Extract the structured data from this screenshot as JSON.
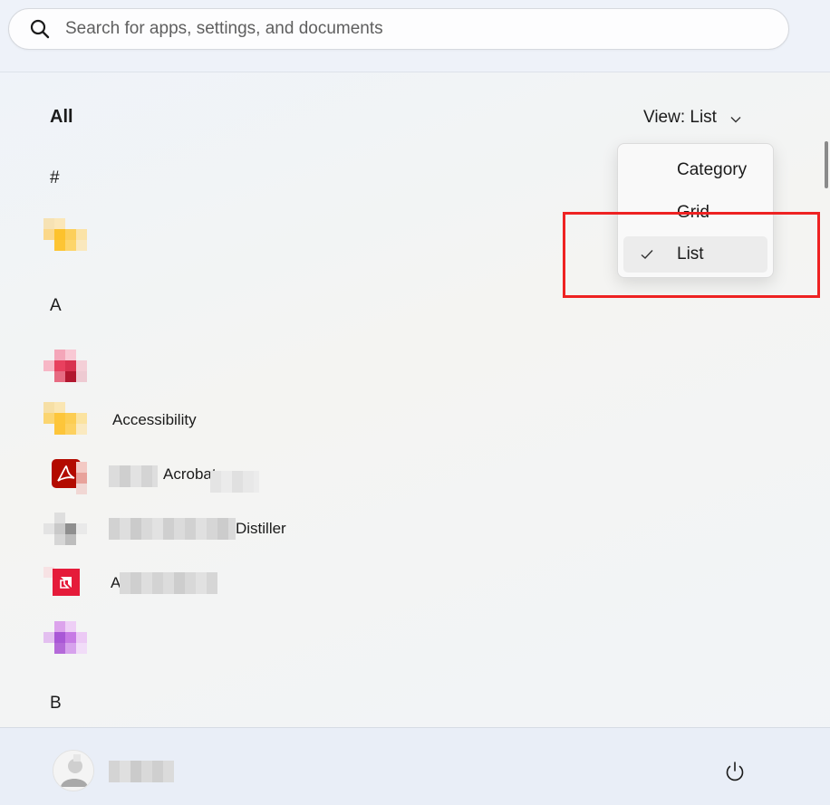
{
  "search": {
    "placeholder": "Search for apps, settings, and documents"
  },
  "header": {
    "all_label": "All",
    "view_label": "View: List"
  },
  "sections": [
    {
      "letter": "#"
    },
    {
      "letter": "A"
    },
    {
      "letter": "B"
    }
  ],
  "apps": [
    {
      "name": "",
      "icon": "folder-icon",
      "blurred": true
    },
    {
      "name": "",
      "icon": "app-icon-pink",
      "blurred": true
    },
    {
      "name": "Accessibility",
      "icon": "folder-icon",
      "blurred": false
    },
    {
      "name": "Acrobat",
      "icon": "acrobat-icon",
      "blurred": false
    },
    {
      "name": "Distiller",
      "icon": "distiller-icon",
      "blurred": false
    },
    {
      "name": "A",
      "icon": "red-app-icon",
      "blurred": false
    },
    {
      "name": "",
      "icon": "purple-app-icon",
      "blurred": true
    }
  ],
  "view_menu": {
    "items": [
      {
        "label": "Category",
        "selected": false
      },
      {
        "label": "Grid",
        "selected": false
      },
      {
        "label": "List",
        "selected": true
      }
    ]
  },
  "colors": {
    "highlight": "#ee2222",
    "acrobat": "#b30b00"
  }
}
